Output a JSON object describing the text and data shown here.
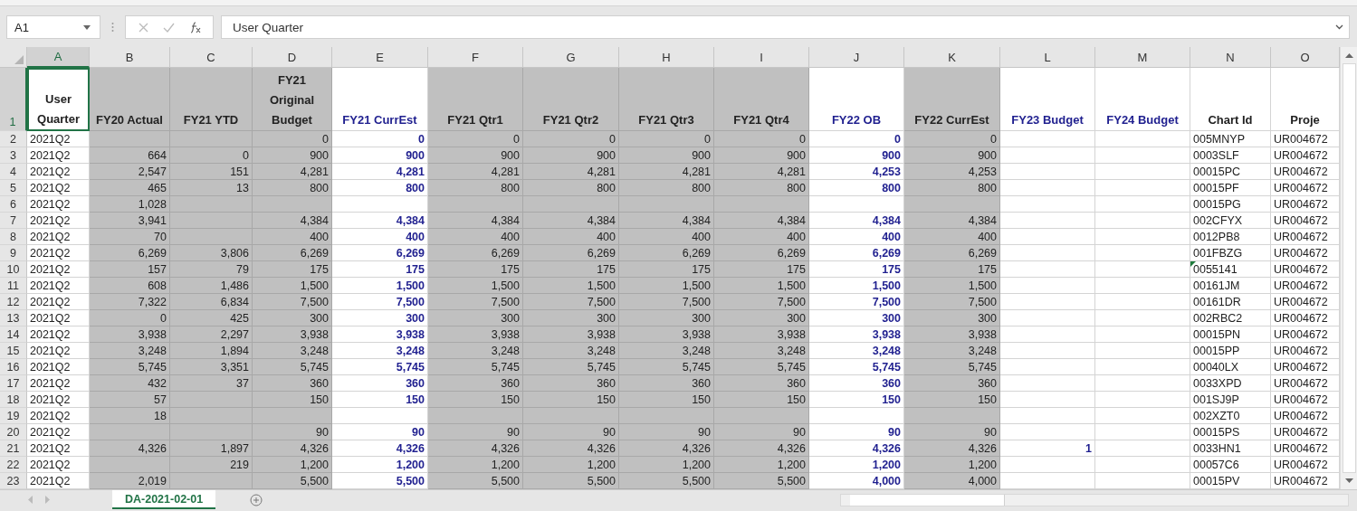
{
  "formula_bar": {
    "name_box": "A1",
    "formula": "User Quarter"
  },
  "columns": [
    {
      "letter": "A",
      "heading": "User Quarter",
      "kind": "text",
      "shaded": false,
      "highlighted": false,
      "selected": true
    },
    {
      "letter": "B",
      "heading": "FY20 Actual",
      "kind": "number",
      "shaded": true,
      "highlighted": false,
      "selected": false
    },
    {
      "letter": "C",
      "heading": "FY21 YTD",
      "kind": "number",
      "shaded": true,
      "highlighted": false,
      "selected": false
    },
    {
      "letter": "D",
      "heading": "FY21 Original Budget",
      "kind": "number",
      "shaded": true,
      "highlighted": false,
      "selected": false
    },
    {
      "letter": "E",
      "heading": "FY21 CurrEst",
      "kind": "number",
      "shaded": false,
      "highlighted": true,
      "selected": false
    },
    {
      "letter": "F",
      "heading": "FY21 Qtr1",
      "kind": "number",
      "shaded": true,
      "highlighted": false,
      "selected": false
    },
    {
      "letter": "G",
      "heading": "FY21 Qtr2",
      "kind": "number",
      "shaded": true,
      "highlighted": false,
      "selected": false
    },
    {
      "letter": "H",
      "heading": "FY21 Qtr3",
      "kind": "number",
      "shaded": true,
      "highlighted": false,
      "selected": false
    },
    {
      "letter": "I",
      "heading": "FY21 Qtr4",
      "kind": "number",
      "shaded": true,
      "highlighted": false,
      "selected": false
    },
    {
      "letter": "J",
      "heading": "FY22 OB",
      "kind": "number",
      "shaded": false,
      "highlighted": true,
      "selected": false
    },
    {
      "letter": "K",
      "heading": "FY22 CurrEst",
      "kind": "number",
      "shaded": true,
      "highlighted": false,
      "selected": false
    },
    {
      "letter": "L",
      "heading": "FY23 Budget",
      "kind": "number",
      "shaded": false,
      "highlighted": true,
      "selected": false
    },
    {
      "letter": "M",
      "heading": "FY24 Budget",
      "kind": "number",
      "shaded": false,
      "highlighted": true,
      "selected": false
    },
    {
      "letter": "N",
      "heading": "Chart Id",
      "kind": "text",
      "shaded": false,
      "highlighted": false,
      "selected": false
    },
    {
      "letter": "O",
      "heading": "Proje",
      "kind": "text",
      "shaded": false,
      "highlighted": false,
      "selected": false
    }
  ],
  "header_row": {
    "number": "1",
    "selected": true
  },
  "rows": [
    {
      "number": "2",
      "warning": false,
      "cells": [
        "2021Q2",
        null,
        null,
        "0",
        "0",
        "0",
        "0",
        "0",
        "0",
        "0",
        "0",
        null,
        null,
        "005MNYP",
        "UR004672"
      ]
    },
    {
      "number": "3",
      "warning": false,
      "cells": [
        "2021Q2",
        "664",
        "0",
        "900",
        "900",
        "900",
        "900",
        "900",
        "900",
        "900",
        "900",
        null,
        null,
        "0003SLF",
        "UR004672"
      ]
    },
    {
      "number": "4",
      "warning": false,
      "cells": [
        "2021Q2",
        "2,547",
        "151",
        "4,281",
        "4,281",
        "4,281",
        "4,281",
        "4,281",
        "4,281",
        "4,253",
        "4,253",
        null,
        null,
        "00015PC",
        "UR004672"
      ]
    },
    {
      "number": "5",
      "warning": false,
      "cells": [
        "2021Q2",
        "465",
        "13",
        "800",
        "800",
        "800",
        "800",
        "800",
        "800",
        "800",
        "800",
        null,
        null,
        "00015PF",
        "UR004672"
      ]
    },
    {
      "number": "6",
      "warning": false,
      "cells": [
        "2021Q2",
        "1,028",
        null,
        null,
        null,
        null,
        null,
        null,
        null,
        null,
        null,
        null,
        null,
        "00015PG",
        "UR004672"
      ]
    },
    {
      "number": "7",
      "warning": false,
      "cells": [
        "2021Q2",
        "3,941",
        null,
        "4,384",
        "4,384",
        "4,384",
        "4,384",
        "4,384",
        "4,384",
        "4,384",
        "4,384",
        null,
        null,
        "002CFYX",
        "UR004672"
      ]
    },
    {
      "number": "8",
      "warning": false,
      "cells": [
        "2021Q2",
        "70",
        null,
        "400",
        "400",
        "400",
        "400",
        "400",
        "400",
        "400",
        "400",
        null,
        null,
        "0012PB8",
        "UR004672"
      ]
    },
    {
      "number": "9",
      "warning": false,
      "cells": [
        "2021Q2",
        "6,269",
        "3,806",
        "6,269",
        "6,269",
        "6,269",
        "6,269",
        "6,269",
        "6,269",
        "6,269",
        "6,269",
        null,
        null,
        "001FBZG",
        "UR004672"
      ]
    },
    {
      "number": "10",
      "warning": true,
      "cells": [
        "2021Q2",
        "157",
        "79",
        "175",
        "175",
        "175",
        "175",
        "175",
        "175",
        "175",
        "175",
        null,
        null,
        "0055141",
        "UR004672"
      ]
    },
    {
      "number": "11",
      "warning": false,
      "cells": [
        "2021Q2",
        "608",
        "1,486",
        "1,500",
        "1,500",
        "1,500",
        "1,500",
        "1,500",
        "1,500",
        "1,500",
        "1,500",
        null,
        null,
        "00161JM",
        "UR004672"
      ]
    },
    {
      "number": "12",
      "warning": false,
      "cells": [
        "2021Q2",
        "7,322",
        "6,834",
        "7,500",
        "7,500",
        "7,500",
        "7,500",
        "7,500",
        "7,500",
        "7,500",
        "7,500",
        null,
        null,
        "00161DR",
        "UR004672"
      ]
    },
    {
      "number": "13",
      "warning": false,
      "cells": [
        "2021Q2",
        "0",
        "425",
        "300",
        "300",
        "300",
        "300",
        "300",
        "300",
        "300",
        "300",
        null,
        null,
        "002RBC2",
        "UR004672"
      ]
    },
    {
      "number": "14",
      "warning": false,
      "cells": [
        "2021Q2",
        "3,938",
        "2,297",
        "3,938",
        "3,938",
        "3,938",
        "3,938",
        "3,938",
        "3,938",
        "3,938",
        "3,938",
        null,
        null,
        "00015PN",
        "UR004672"
      ]
    },
    {
      "number": "15",
      "warning": false,
      "cells": [
        "2021Q2",
        "3,248",
        "1,894",
        "3,248",
        "3,248",
        "3,248",
        "3,248",
        "3,248",
        "3,248",
        "3,248",
        "3,248",
        null,
        null,
        "00015PP",
        "UR004672"
      ]
    },
    {
      "number": "16",
      "warning": false,
      "cells": [
        "2021Q2",
        "5,745",
        "3,351",
        "5,745",
        "5,745",
        "5,745",
        "5,745",
        "5,745",
        "5,745",
        "5,745",
        "5,745",
        null,
        null,
        "00040LX",
        "UR004672"
      ]
    },
    {
      "number": "17",
      "warning": false,
      "cells": [
        "2021Q2",
        "432",
        "37",
        "360",
        "360",
        "360",
        "360",
        "360",
        "360",
        "360",
        "360",
        null,
        null,
        "0033XPD",
        "UR004672"
      ]
    },
    {
      "number": "18",
      "warning": false,
      "cells": [
        "2021Q2",
        "57",
        null,
        "150",
        "150",
        "150",
        "150",
        "150",
        "150",
        "150",
        "150",
        null,
        null,
        "001SJ9P",
        "UR004672"
      ]
    },
    {
      "number": "19",
      "warning": false,
      "cells": [
        "2021Q2",
        "18",
        null,
        null,
        null,
        null,
        null,
        null,
        null,
        null,
        null,
        null,
        null,
        "002XZT0",
        "UR004672"
      ]
    },
    {
      "number": "20",
      "warning": false,
      "cells": [
        "2021Q2",
        null,
        null,
        "90",
        "90",
        "90",
        "90",
        "90",
        "90",
        "90",
        "90",
        null,
        null,
        "00015PS",
        "UR004672"
      ]
    },
    {
      "number": "21",
      "warning": false,
      "cells": [
        "2021Q2",
        "4,326",
        "1,897",
        "4,326",
        "4,326",
        "4,326",
        "4,326",
        "4,326",
        "4,326",
        "4,326",
        "4,326",
        "1",
        null,
        "0033HN1",
        "UR004672"
      ]
    },
    {
      "number": "22",
      "warning": false,
      "cells": [
        "2021Q2",
        null,
        "219",
        "1,200",
        "1,200",
        "1,200",
        "1,200",
        "1,200",
        "1,200",
        "1,200",
        "1,200",
        null,
        null,
        "00057C6",
        "UR004672"
      ]
    },
    {
      "number": "23",
      "warning": false,
      "cells": [
        "2021Q2",
        "2,019",
        null,
        "5,500",
        "5,500",
        "5,500",
        "5,500",
        "5,500",
        "5,500",
        "4,000",
        "4,000",
        null,
        null,
        "00015PV",
        "UR004672"
      ]
    }
  ],
  "sheet_tabs": [
    {
      "label": "DA-2021-02-01",
      "selected": true
    }
  ]
}
